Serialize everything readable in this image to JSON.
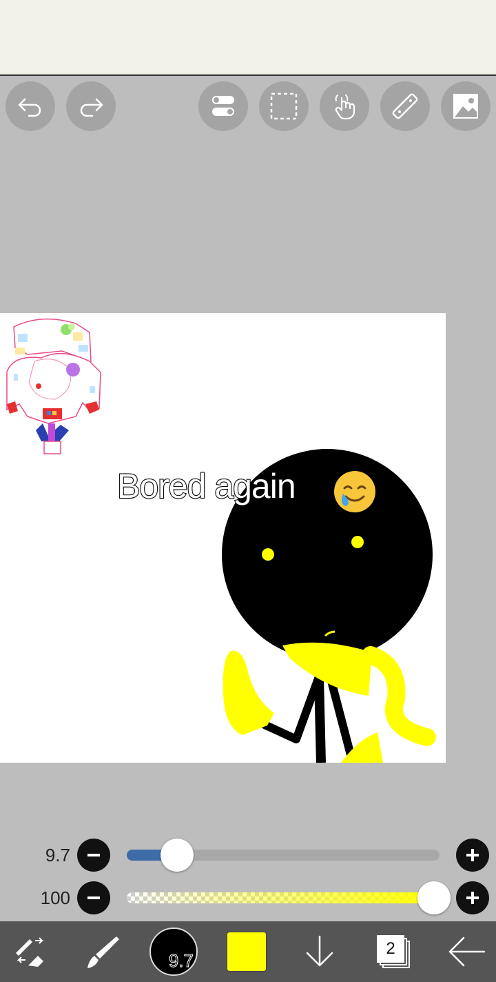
{
  "canvas": {
    "caption": "Bored again",
    "caption_emoji": "smiling-face-with-tear-icon",
    "brush_color": "#ffff00"
  },
  "sliders": {
    "brush_size": {
      "value_label": "9.7",
      "fraction": 0.16
    },
    "opacity": {
      "value_label": "100",
      "fraction": 1.0
    }
  },
  "bottombar": {
    "brush_preview_label": "9.7",
    "layer_count": "2",
    "color_swatch": "#ffff00"
  },
  "colors": {
    "accent": "#3d6ca8",
    "topbar": "#f2f1e8",
    "workspace": "#bdbdbd",
    "bottombar": "#555555",
    "tool_button": "#a4a4a4"
  },
  "toolbar": {
    "icons": [
      "undo-icon",
      "redo-icon",
      "toggle-settings-icon",
      "selection-icon",
      "hand-gesture-icon",
      "ruler-icon",
      "image-icon"
    ]
  }
}
